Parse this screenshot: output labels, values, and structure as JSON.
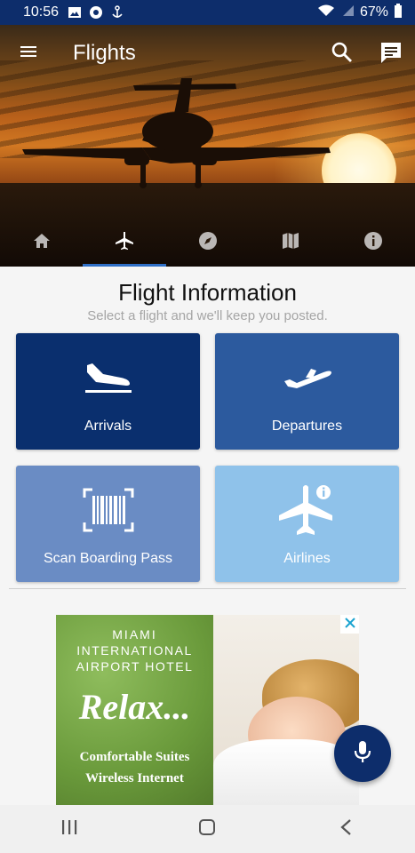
{
  "status_bar": {
    "time": "10:56",
    "battery": "67%",
    "icons": [
      "image-icon",
      "chrome-icon",
      "anchor-icon",
      "wifi-icon",
      "signal-icon",
      "battery-icon"
    ]
  },
  "app_bar": {
    "title": "Flights",
    "icons": [
      "menu-icon",
      "search-icon",
      "chat-icon"
    ]
  },
  "tabs": [
    {
      "icon": "home-icon",
      "active": false
    },
    {
      "icon": "airplane-icon",
      "active": true
    },
    {
      "icon": "compass-icon",
      "active": false
    },
    {
      "icon": "map-icon",
      "active": false
    },
    {
      "icon": "info-icon",
      "active": false
    }
  ],
  "main": {
    "heading": "Flight Information",
    "subheading": "Select a flight and we'll keep you posted.",
    "cards": [
      {
        "label": "Arrivals",
        "icon": "arrivals-icon",
        "color": "#0a2f6e"
      },
      {
        "label": "Departures",
        "icon": "departures-icon",
        "color": "#2c5a9e"
      },
      {
        "label": "Scan Boarding Pass",
        "icon": "barcode-scan-icon",
        "color": "#6a8cc4"
      },
      {
        "label": "Airlines",
        "icon": "airline-info-icon",
        "color": "#8fc2ea"
      }
    ]
  },
  "ad": {
    "line1": "MIAMI",
    "line2": "INTERNATIONAL",
    "line3": "AIRPORT HOTEL",
    "tagline": "Relax...",
    "line4": "Comfortable Suites",
    "line5": "Wireless Internet"
  },
  "fab": {
    "icon": "microphone-icon",
    "color": "#0d2d6b"
  },
  "nav_bar": {
    "icons": [
      "recents-icon",
      "home-button-icon",
      "back-icon"
    ]
  },
  "colors": {
    "primary_dark": "#0d2d6b",
    "accent": "#2f6fc6",
    "background": "#f5f5f5"
  }
}
